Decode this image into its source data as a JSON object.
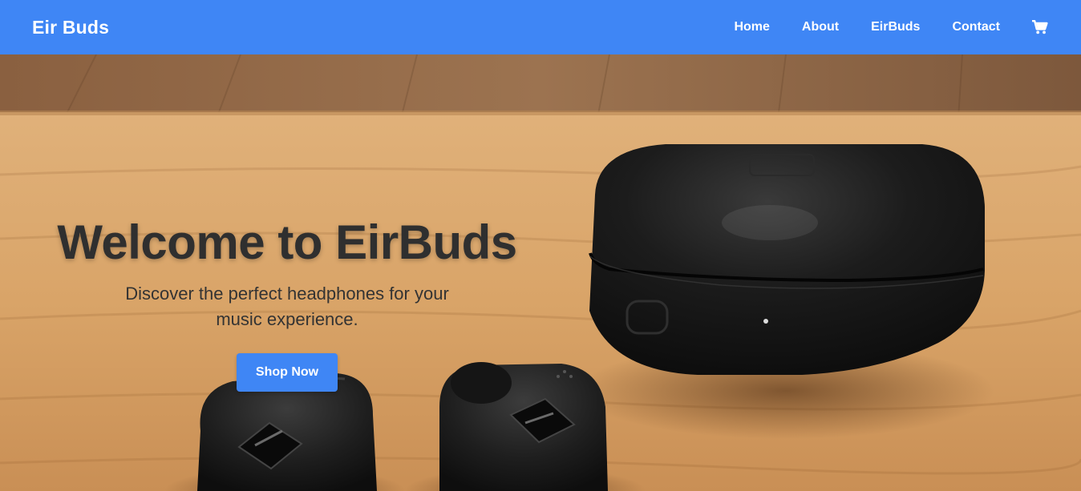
{
  "header": {
    "brand": "Eir Buds",
    "nav": [
      "Home",
      "About",
      "EirBuds",
      "Contact"
    ],
    "cart_icon": "cart-icon",
    "background_color": "#3f86f5"
  },
  "hero": {
    "title": "Welcome to EirBuds",
    "subtitle": "Discover the perfect headphones for your music experience.",
    "cta_label": "Shop Now",
    "cta_color": "#3f86f5",
    "image": "earbuds-and-charging-case-on-wooden-table"
  }
}
